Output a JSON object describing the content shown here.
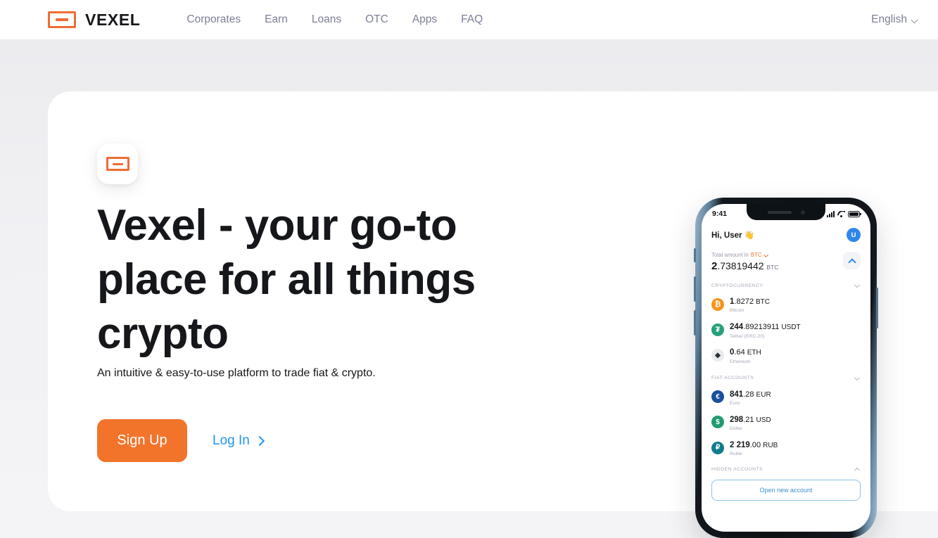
{
  "header": {
    "brand": "VEXEL",
    "brand_mark_icon": "vexel-logo-icon",
    "nav": [
      {
        "label": "Corporates"
      },
      {
        "label": "Earn"
      },
      {
        "label": "Loans"
      },
      {
        "label": "OTC"
      },
      {
        "label": "Apps"
      },
      {
        "label": "FAQ"
      }
    ],
    "language": "English",
    "language_chevron_icon": "chevron-down-icon"
  },
  "hero": {
    "badge_icon": "vexel-logo-icon",
    "headline": "Vexel - your go-to place for all things crypto",
    "subhead": "An intuitive & easy-to-use platform to trade fiat & crypto.",
    "signup_label": "Sign Up",
    "login_label": "Log In",
    "login_chevron_icon": "chevron-right-icon"
  },
  "phone": {
    "status": {
      "time": "9:41",
      "signal_icon": "cellular-signal-icon",
      "wifi_icon": "wifi-icon",
      "battery_icon": "battery-full-icon"
    },
    "greeting": "Hi, User 👋",
    "avatar_initial": "U",
    "total": {
      "label_prefix": "Total amount in",
      "currency": "BTC",
      "currency_chevron_icon": "chevron-down-icon",
      "integer": "2",
      "fraction": ".73819442",
      "unit": "BTC",
      "collapse_icon": "chevron-up-icon"
    },
    "sections": [
      {
        "title": "CRYPTOCURRENCY",
        "chevron_icon": "chevron-down-icon",
        "accounts": [
          {
            "icon": "bitcoin-icon",
            "glyph": "₿",
            "color": "#f7931a",
            "integer": "1",
            "fraction": ".8272",
            "currency": "BTC",
            "name": "Bitcoin"
          },
          {
            "icon": "tether-icon",
            "glyph": "₮",
            "color": "#26a17b",
            "integer": "244",
            "fraction": ".89213911",
            "currency": "USDT",
            "name": "Tether (ERC-20)"
          },
          {
            "icon": "ethereum-icon",
            "glyph": "◆",
            "color": "#e9ebee",
            "integer": "0",
            "fraction": ".64",
            "currency": "ETH",
            "name": "Ethereum"
          }
        ]
      },
      {
        "title": "FIAT ACCOUNTS",
        "chevron_icon": "chevron-down-icon",
        "accounts": [
          {
            "icon": "euro-icon",
            "glyph": "€",
            "color": "#1a4f9c",
            "integer": "841",
            "fraction": ".28",
            "currency": "EUR",
            "name": "Euro"
          },
          {
            "icon": "dollar-icon",
            "glyph": "$",
            "color": "#229a72",
            "integer": "298",
            "fraction": ".21",
            "currency": "USD",
            "name": "Dollar"
          },
          {
            "icon": "ruble-icon",
            "glyph": "₽",
            "color": "#137b8e",
            "integer": "2 219",
            "fraction": ".00",
            "currency": "RUB",
            "name": "Ruble"
          }
        ]
      }
    ],
    "hidden_section": {
      "title": "HIDDEN ACCOUNTS",
      "chevron_icon": "chevron-up-icon"
    },
    "open_account_label": "Open new account"
  },
  "colors": {
    "accent_orange": "#f2742b",
    "link_blue": "#2196f3",
    "page_bg": "#f4f4f6",
    "text_dark": "#15171a",
    "muted": "#7c7f96"
  }
}
